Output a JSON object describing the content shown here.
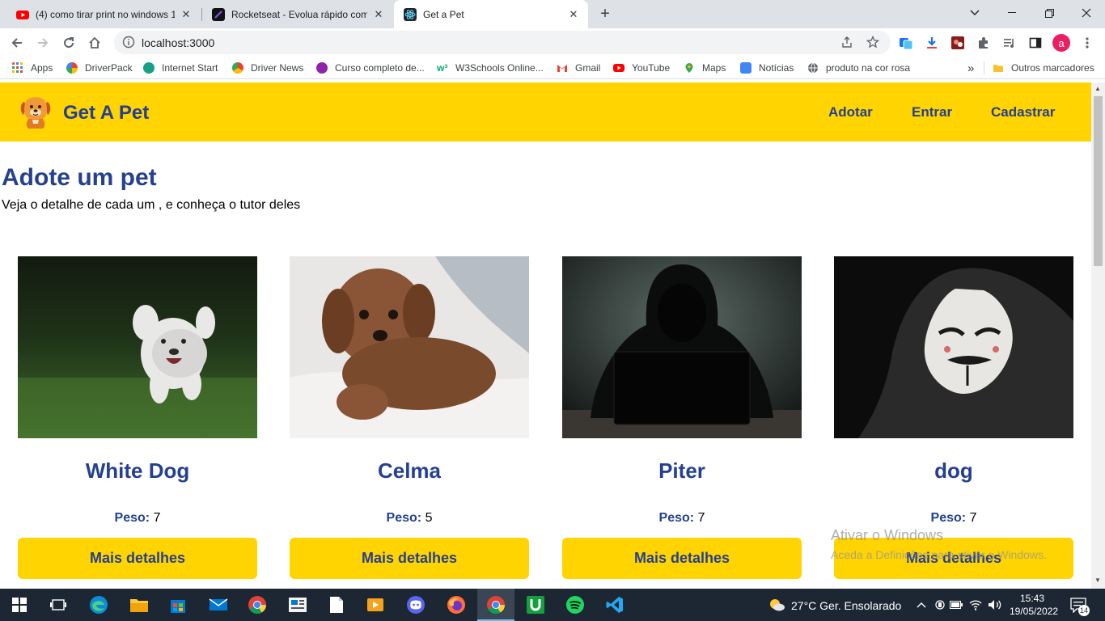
{
  "browser": {
    "tabs": [
      {
        "title": "(4) como tirar print no windows 1",
        "favicon": "youtube-icon",
        "active": false
      },
      {
        "title": "Rocketseat - Evolua rápido como",
        "favicon": "rocketseat-icon",
        "active": false
      },
      {
        "title": "Get a Pet",
        "favicon": "react-icon",
        "active": true
      }
    ],
    "new_tab_label": "+",
    "url": "localhost:3000",
    "profile_initial": "a",
    "bookmarks": [
      {
        "label": "Apps",
        "icon": "apps-grid-icon"
      },
      {
        "label": "DriverPack",
        "icon": "driverpack-icon"
      },
      {
        "label": "Internet Start",
        "icon": "internet-start-icon"
      },
      {
        "label": "Driver News",
        "icon": "driver-news-icon"
      },
      {
        "label": "Curso completo de...",
        "icon": "course-icon"
      },
      {
        "label": "W3Schools Online...",
        "icon": "w3schools-icon"
      },
      {
        "label": "Gmail",
        "icon": "gmail-icon"
      },
      {
        "label": "YouTube",
        "icon": "youtube-icon"
      },
      {
        "label": "Maps",
        "icon": "maps-icon"
      },
      {
        "label": "Notícias",
        "icon": "news-icon"
      },
      {
        "label": "produto na cor rosa",
        "icon": "globe-icon"
      }
    ],
    "overflow_label": "»",
    "other_bookmarks": "Outros marcadores"
  },
  "site": {
    "brand": "Get A Pet",
    "nav": [
      "Adotar",
      "Entrar",
      "Cadastrar"
    ],
    "heading": "Adote um pet",
    "subheading": "Veja o detalhe de cada um , e conheça o tutor deles",
    "weight_label": "Peso:",
    "details_label": "Mais detalhes",
    "pets": [
      {
        "name": "White Dog",
        "weight": "7",
        "photo": "white-dog-photo"
      },
      {
        "name": "Celma",
        "weight": "5",
        "photo": "brown-dog-photo"
      },
      {
        "name": "Piter",
        "weight": "7",
        "photo": "hooded-hacker-photo"
      },
      {
        "name": "dog",
        "weight": "7",
        "photo": "anonymous-mask-photo"
      }
    ]
  },
  "watermark": {
    "line1": "Ativar o Windows",
    "line2": "Aceda a Definições para ativar o Windows."
  },
  "taskbar": {
    "weather": "27°C  Ger. Ensolarado",
    "time": "15:43",
    "date": "19/05/2022",
    "notifications": "14"
  }
}
